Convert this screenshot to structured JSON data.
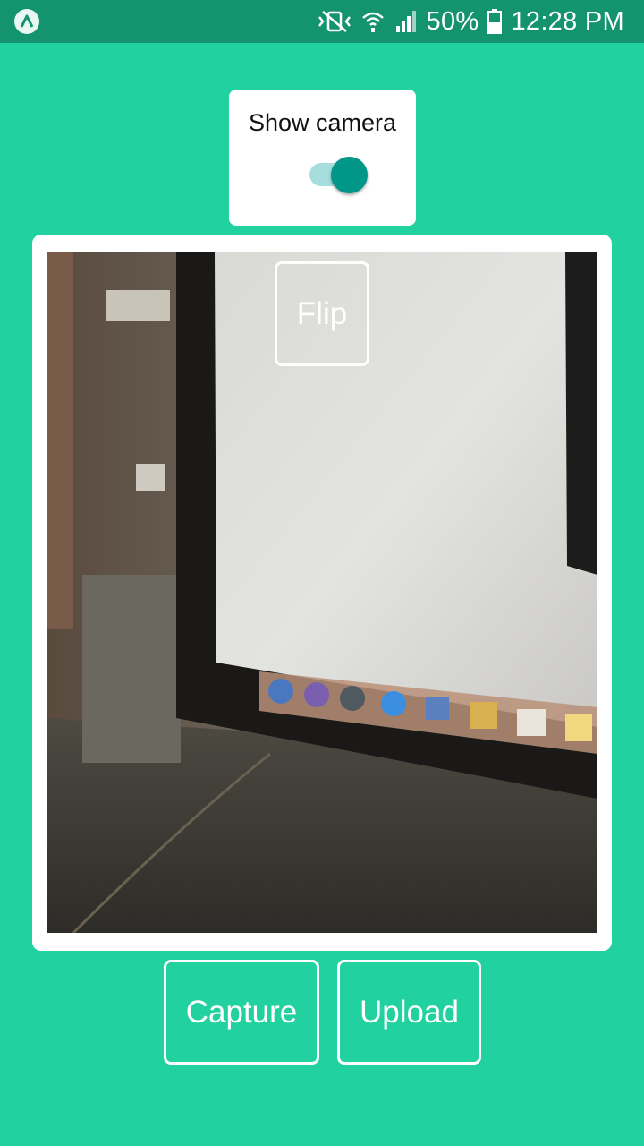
{
  "status_bar": {
    "app_icon": "expo-icon",
    "icons": [
      "vibrate-mute-icon",
      "wifi-icon",
      "signal-icon",
      "battery-icon"
    ],
    "battery": "50%",
    "time": "12:28 PM"
  },
  "toggle_card": {
    "label": "Show camera",
    "switch_on": true
  },
  "camera": {
    "flip_label": "Flip"
  },
  "actions": {
    "capture_label": "Capture",
    "upload_label": "Upload"
  },
  "colors": {
    "background": "#21d1a0",
    "status_bar": "#13946e",
    "switch_thumb": "#009688",
    "switch_track": "#a6dedd"
  }
}
